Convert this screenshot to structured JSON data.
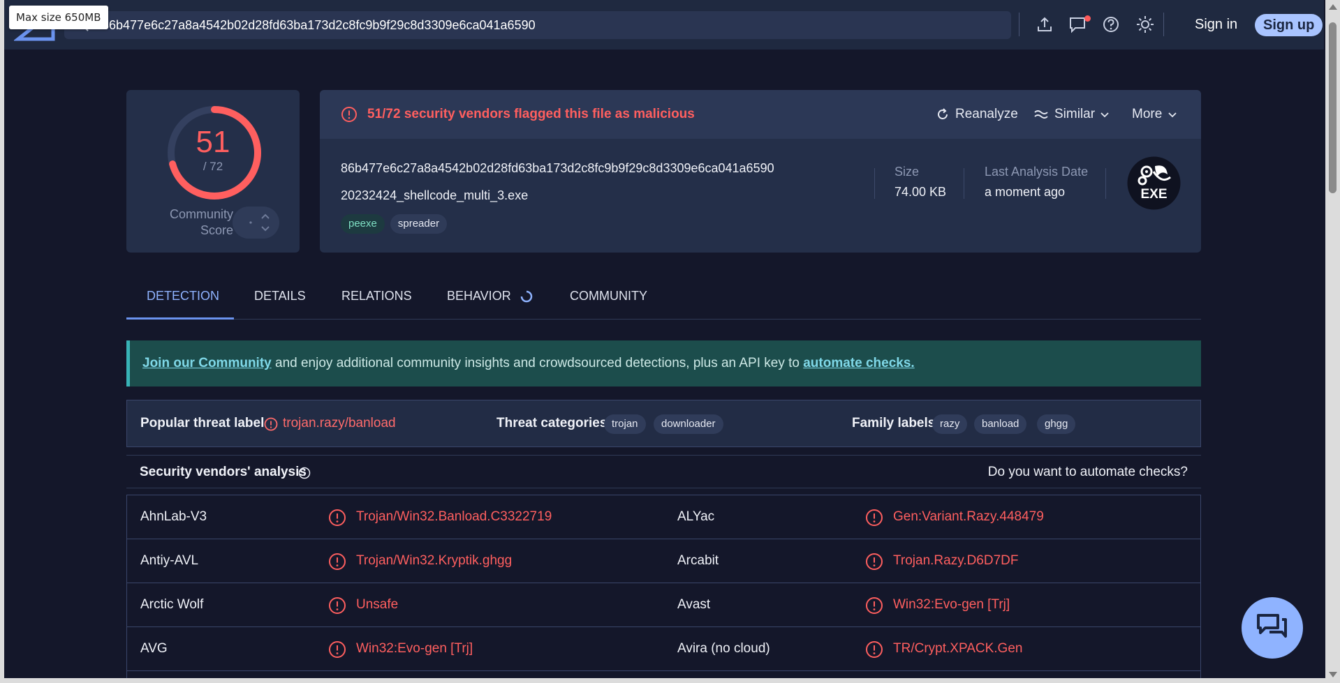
{
  "tooltip": "Max size 650MB",
  "search": {
    "value": "86b477e6c27a8a4542b02d28fd63ba173d2c8fc9b9f29c8d3309e6ca041a6590"
  },
  "header": {
    "signin_label": "Sign in",
    "signup_label": "Sign up"
  },
  "score": {
    "detections": 51,
    "total_label": "/ 72",
    "total": 72,
    "community_label_1": "Community",
    "community_label_2": "Score"
  },
  "summary": {
    "flag_text": "51/72 security vendors flagged this file as malicious",
    "reanalyze_label": "Reanalyze",
    "similar_label": "Similar",
    "more_label": "More",
    "hash": "86b477e6c27a8a4542b02d28fd63ba173d2c8fc9b9f29c8d3309e6ca041a6590",
    "filename": "20232424_shellcode_multi_3.exe",
    "tags": [
      "peexe",
      "spreader"
    ],
    "size_label": "Size",
    "size_value": "74.00 KB",
    "date_label": "Last Analysis Date",
    "date_value": "a moment ago",
    "file_type": "EXE"
  },
  "tabs": [
    "DETECTION",
    "DETAILS",
    "RELATIONS",
    "BEHAVIOR",
    "COMMUNITY"
  ],
  "banner": {
    "link1": "Join our Community",
    "text": " and enjoy additional community insights and crowdsourced detections, plus an API key to ",
    "link2": "automate checks."
  },
  "threat": {
    "popular_label": "Popular threat label",
    "popular_value": "trojan.razy/banload",
    "categories_label": "Threat categories",
    "categories": [
      "trojan",
      "downloader"
    ],
    "family_label": "Family labels",
    "families": [
      "razy",
      "banload",
      "ghgg"
    ]
  },
  "vendors": {
    "title": "Security vendors' analysis",
    "automate_label": "Do you want to automate checks?",
    "rows": [
      {
        "left_name": "AhnLab-V3",
        "left_result": "Trojan/Win32.Banload.C3322719",
        "right_name": "ALYac",
        "right_result": "Gen:Variant.Razy.448479"
      },
      {
        "left_name": "Antiy-AVL",
        "left_result": "Trojan/Win32.Kryptik.ghgg",
        "right_name": "Arcabit",
        "right_result": "Trojan.Razy.D6D7DF"
      },
      {
        "left_name": "Arctic Wolf",
        "left_result": "Unsafe",
        "right_name": "Avast",
        "right_result": "Win32:Evo-gen [Trj]"
      },
      {
        "left_name": "AVG",
        "left_result": "Win32:Evo-gen [Trj]",
        "right_name": "Avira (no cloud)",
        "right_result": "TR/Crypt.XPACK.Gen"
      }
    ]
  },
  "colors": {
    "danger": "#ff5f5f",
    "accent": "#8fb3ff",
    "banner_bg": "#1c4d4c"
  }
}
